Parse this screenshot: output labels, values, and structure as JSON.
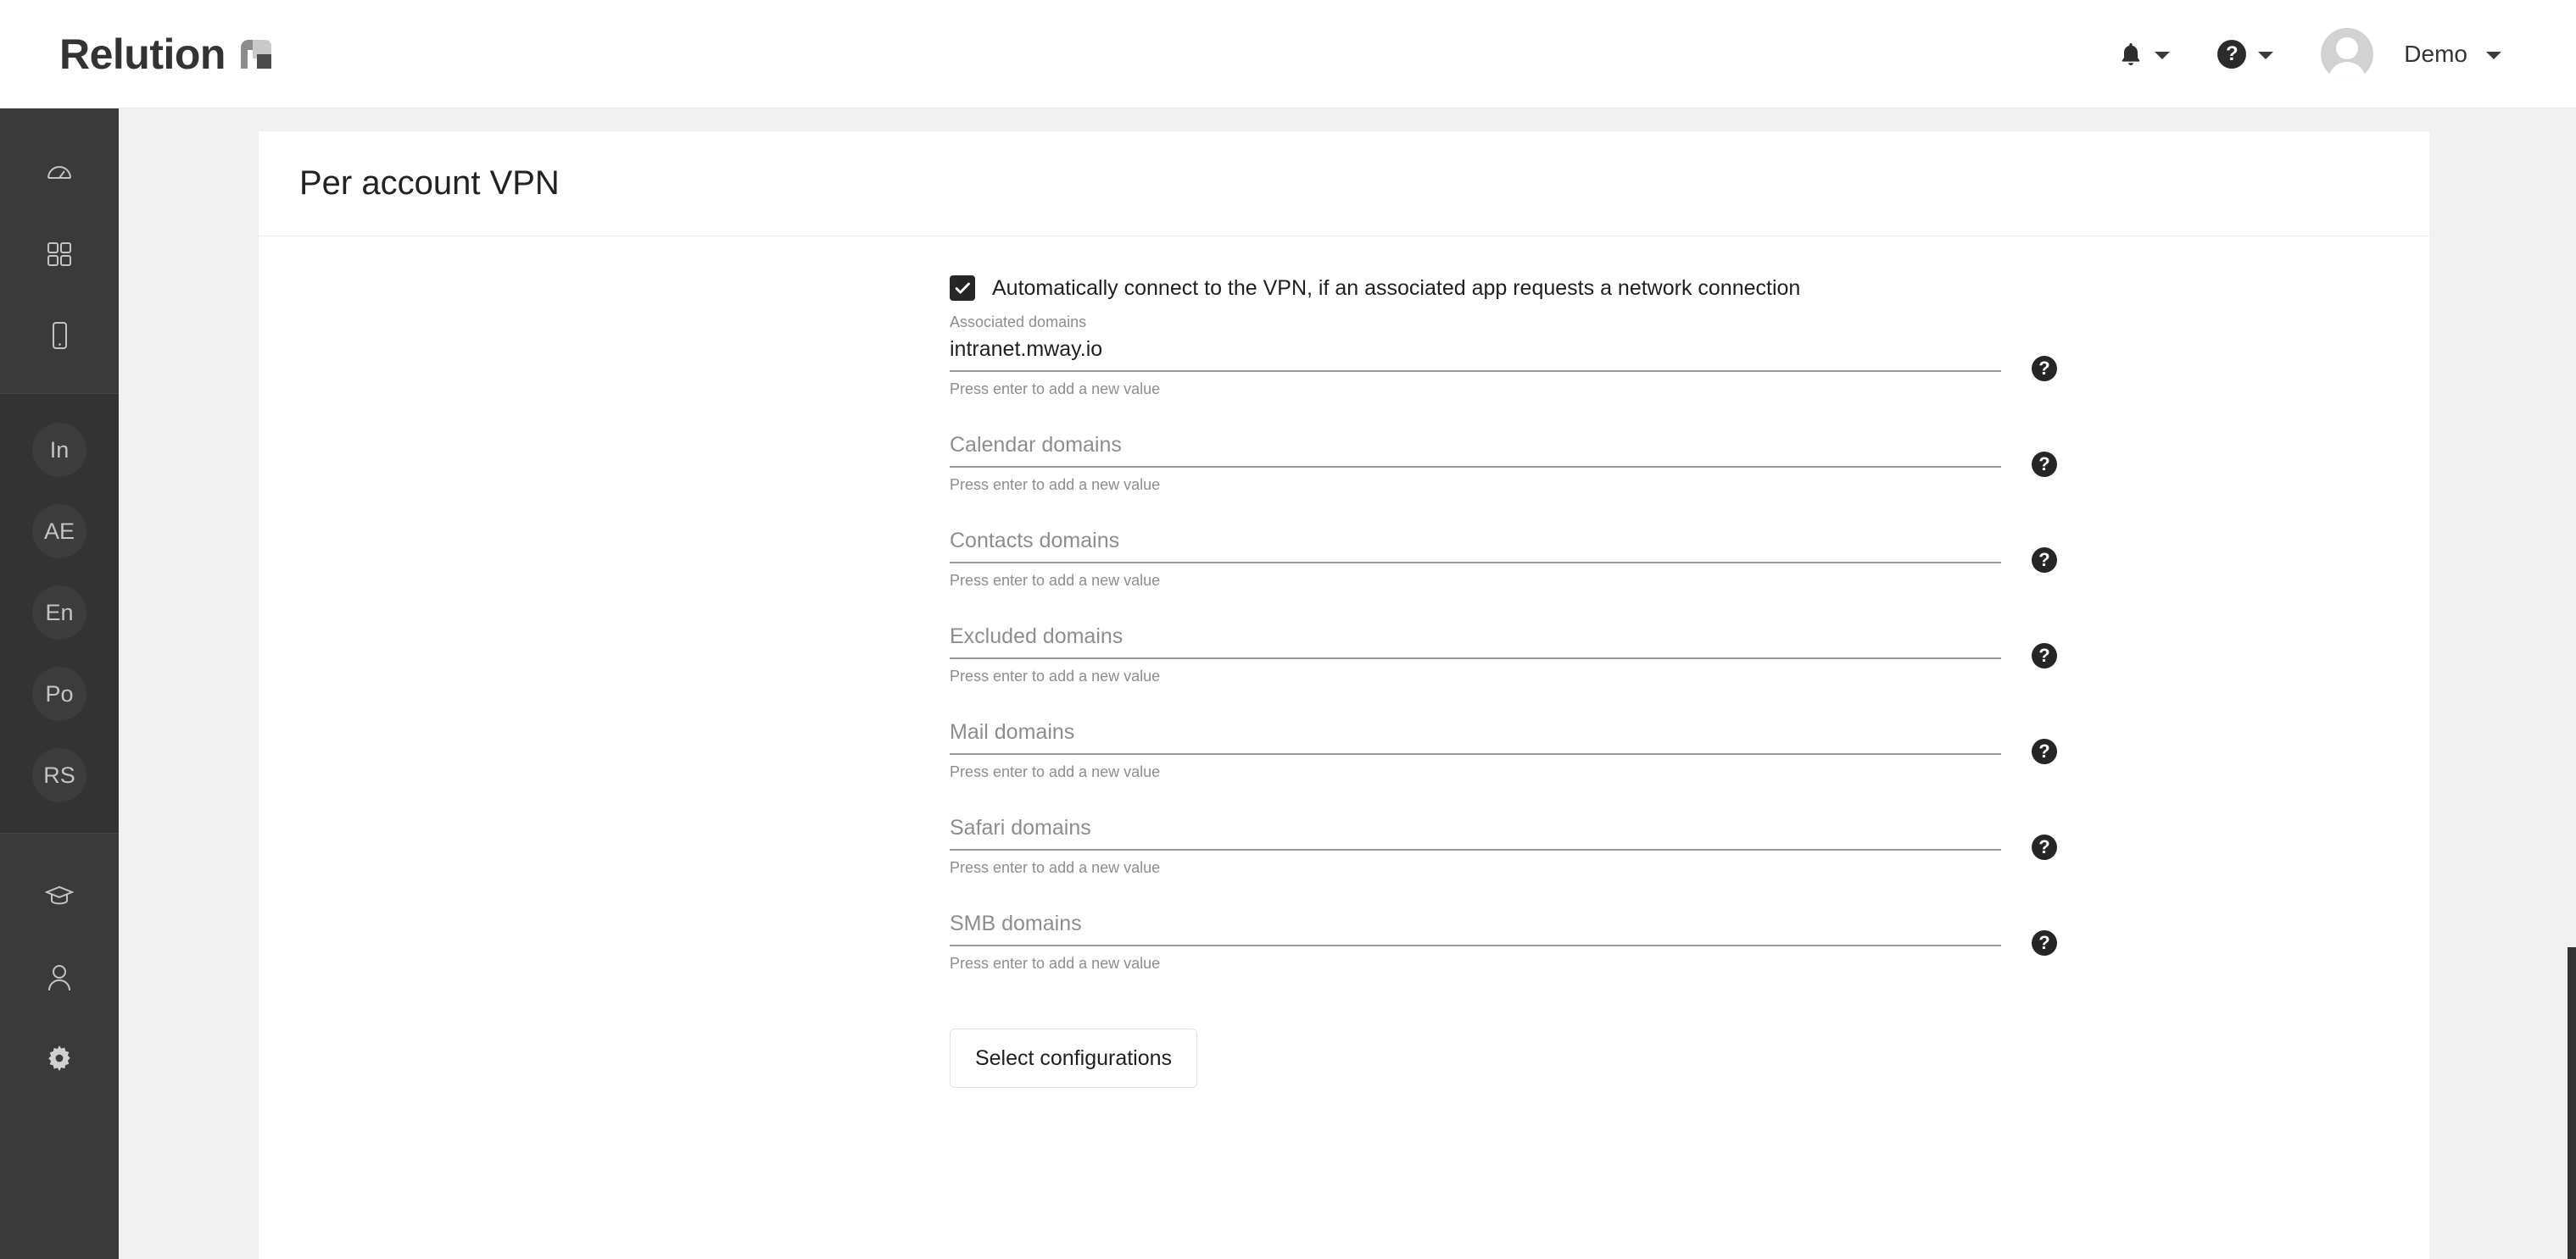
{
  "header": {
    "brand_text": "Relution",
    "brand_mark_icon": "relution-logo-mark",
    "notifications_icon": "bell-icon",
    "notifications_chevron_icon": "chevron-down-icon",
    "help_icon": "question-circle-icon",
    "help_label": "?",
    "help_chevron_icon": "chevron-down-icon",
    "avatar_icon": "user-avatar",
    "user_name": "Demo",
    "user_chevron_icon": "chevron-down-icon"
  },
  "sidebar": {
    "top_items": [
      {
        "icon": "dashboard-gauge-icon",
        "label": ""
      },
      {
        "icon": "apps-grid-icon",
        "label": ""
      },
      {
        "icon": "device-mobile-icon",
        "label": ""
      }
    ],
    "mid_items": [
      {
        "icon": "",
        "label": "In"
      },
      {
        "icon": "",
        "label": "AE"
      },
      {
        "icon": "",
        "label": "En"
      },
      {
        "icon": "",
        "label": "Po"
      },
      {
        "icon": "",
        "label": "RS"
      }
    ],
    "bottom_items": [
      {
        "icon": "graduation-cap-icon",
        "label": ""
      },
      {
        "icon": "user-icon",
        "label": ""
      },
      {
        "icon": "gear-icon",
        "label": ""
      }
    ]
  },
  "main": {
    "page_title": "Per account VPN",
    "auto_connect": {
      "checked": true,
      "label": "Automatically connect to the VPN, if an associated app requests a network connection"
    },
    "hint_text": "Press enter to add a new value",
    "help_glyph": "?",
    "fields": [
      {
        "label": "Associated domains",
        "value": "intranet.mway.io",
        "placeholder": "",
        "hint": "Press enter to add a new value",
        "help_icon": "help-circle-icon"
      },
      {
        "label": "",
        "value": "",
        "placeholder": "Calendar domains",
        "hint": "Press enter to add a new value",
        "help_icon": "help-circle-icon"
      },
      {
        "label": "",
        "value": "",
        "placeholder": "Contacts domains",
        "hint": "Press enter to add a new value",
        "help_icon": "help-circle-icon"
      },
      {
        "label": "",
        "value": "",
        "placeholder": "Excluded domains",
        "hint": "Press enter to add a new value",
        "help_icon": "help-circle-icon"
      },
      {
        "label": "",
        "value": "",
        "placeholder": "Mail domains",
        "hint": "Press enter to add a new value",
        "help_icon": "help-circle-icon"
      },
      {
        "label": "",
        "value": "",
        "placeholder": "Safari domains",
        "hint": "Press enter to add a new value",
        "help_icon": "help-circle-icon"
      },
      {
        "label": "",
        "value": "",
        "placeholder": "SMB domains",
        "hint": "Press enter to add a new value",
        "help_icon": "help-circle-icon"
      }
    ],
    "select_configurations_label": "Select configurations"
  },
  "colors": {
    "sidebar_bg": "#3a3a3a",
    "sidebar_mid_bg": "#333333",
    "content_bg": "#f1f1f1",
    "card_bg": "#ffffff",
    "accent_dark": "#262626",
    "underline": "#9a9a9a",
    "muted_text": "#8d8d8d",
    "scrollbar_thumb": "#333333"
  }
}
